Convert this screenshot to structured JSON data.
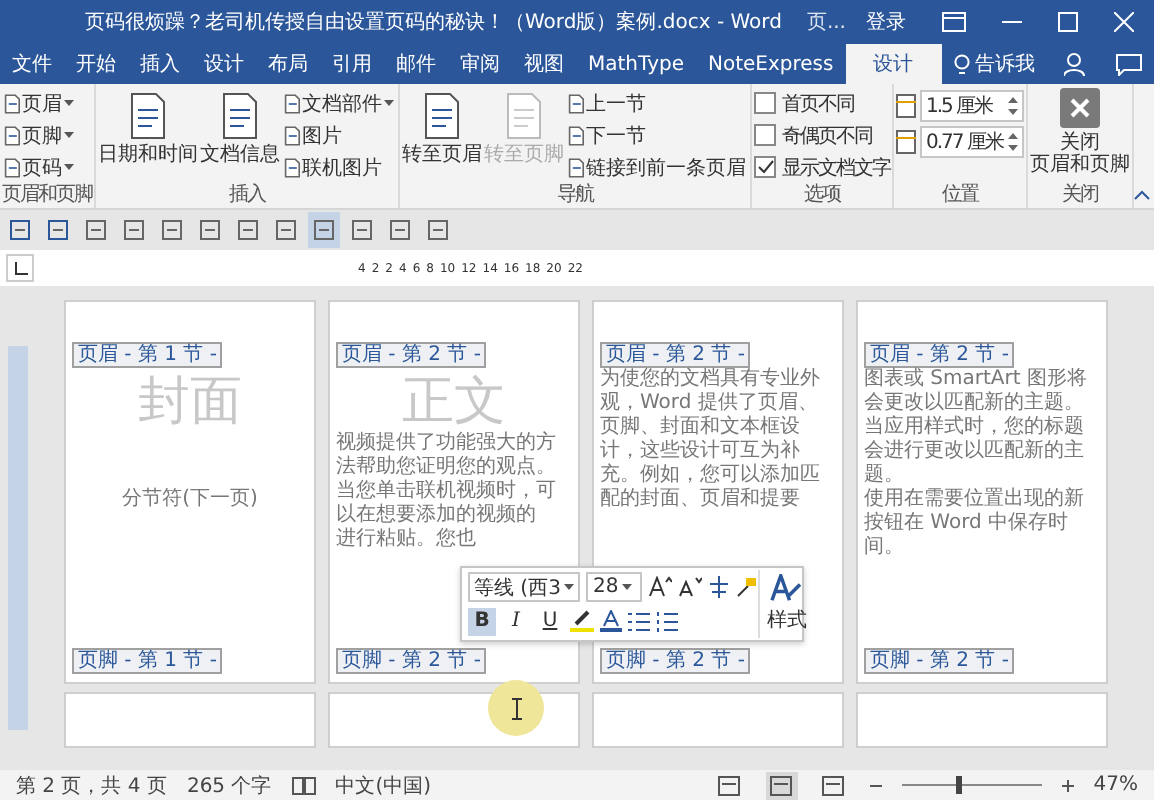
{
  "window": {
    "title": "页码很烦躁？老司机传授自由设置页码的秘诀！（Word版）案例.docx - Word",
    "account": "页...",
    "sign_in": "登录"
  },
  "tabs": [
    {
      "label": "文件",
      "selected": false
    },
    {
      "label": "开始",
      "selected": false
    },
    {
      "label": "插入",
      "selected": false
    },
    {
      "label": "设计",
      "selected": false
    },
    {
      "label": "布局",
      "selected": false
    },
    {
      "label": "引用",
      "selected": false
    },
    {
      "label": "邮件",
      "selected": false
    },
    {
      "label": "审阅",
      "selected": false
    },
    {
      "label": "视图",
      "selected": false
    },
    {
      "label": "MathType",
      "selected": false
    },
    {
      "label": "NoteExpress",
      "selected": false
    },
    {
      "label": "设计",
      "selected": true
    }
  ],
  "tell_me": "告诉我",
  "ribbon": [
    {
      "label": "页眉和页脚",
      "items": [
        {
          "kind": "small",
          "label": "页眉",
          "dropdown": true,
          "disabled": false
        },
        {
          "kind": "small",
          "label": "页脚",
          "dropdown": true,
          "disabled": false
        },
        {
          "kind": "small",
          "label": "页码",
          "dropdown": true,
          "disabled": false
        }
      ]
    },
    {
      "label": "插入",
      "items": [
        {
          "kind": "large",
          "label": "日期和时间",
          "disabled": false
        },
        {
          "kind": "large",
          "label": "文档信息",
          "disabled": false
        },
        {
          "kind": "small",
          "label": "文档部件",
          "dropdown": true,
          "disabled": false
        },
        {
          "kind": "small",
          "label": "图片",
          "dropdown": false,
          "disabled": false
        },
        {
          "kind": "small",
          "label": "联机图片",
          "dropdown": false,
          "disabled": false
        }
      ]
    },
    {
      "label": "导航",
      "items": [
        {
          "kind": "large",
          "label": "转至页眉",
          "disabled": false
        },
        {
          "kind": "large",
          "label": "转至页脚",
          "disabled": true
        },
        {
          "kind": "small",
          "label": "上一节",
          "dropdown": false,
          "disabled": false
        },
        {
          "kind": "small",
          "label": "下一节",
          "dropdown": false,
          "disabled": false
        },
        {
          "kind": "small",
          "label": "链接到前一条页眉",
          "dropdown": false,
          "disabled": false
        }
      ]
    },
    {
      "label": "选项",
      "items": [
        {
          "kind": "check",
          "label": "首页不同",
          "checked": false
        },
        {
          "kind": "check",
          "label": "奇偶页不同",
          "checked": false
        },
        {
          "kind": "check",
          "label": "显示文档文字",
          "checked": true
        }
      ]
    },
    {
      "label": "位置",
      "items": [
        {
          "kind": "spin",
          "value": "1.5 厘米"
        },
        {
          "kind": "spin",
          "value": "0.77 厘米"
        }
      ]
    },
    {
      "label": "关闭",
      "items": [
        {
          "kind": "close",
          "label_lines": [
            "关闭",
            "页眉和页脚"
          ]
        }
      ]
    }
  ],
  "quick_access": [
    {
      "pressed": false
    },
    {
      "pressed": false
    },
    {
      "pressed": false
    },
    {
      "pressed": false
    },
    {
      "pressed": false
    },
    {
      "pressed": false
    },
    {
      "pressed": false
    },
    {
      "pressed": false
    },
    {
      "pressed": true
    },
    {
      "pressed": false
    },
    {
      "pressed": false
    },
    {
      "pressed": false
    }
  ],
  "ruler": {
    "labels": [
      "4",
      "2",
      "2",
      "4",
      "6",
      "8",
      "10",
      "12",
      "14",
      "16",
      "18",
      "20",
      "22"
    ]
  },
  "pages": [
    {
      "header_tag": "页眉 - 第 1 节 -",
      "title": "封面",
      "section_break": "分节符(下一页)",
      "footer_tag": "页脚 - 第 1 节 -"
    },
    {
      "header_tag": "页眉 - 第 2 节 -",
      "title": "正文",
      "paragraphs": [
        "视频提供了功能强大的方法帮助您证明您的观点。当您单击联机视频时，可以在想要添加的视频的",
        "进行粘贴。您也"
      ],
      "footer_tag": "页脚 - 第 2 节 -"
    },
    {
      "header_tag": "页眉 - 第 2 节 -",
      "paragraphs": [
        "为使您的文档具有专业外观，Word 提供了页眉、页脚、封面和文本框设计，这些设计可互为补充。例如，您可以添加匹配的封面、页眉和提要"
      ],
      "footer_tag": "页脚 - 第 2 节 -"
    },
    {
      "header_tag": "页眉 - 第 2 节 -",
      "paragraphs": [
        "图表或 SmartArt 图形将会更改以匹配新的主题。当应用样式时，您的标题会进行更改以匹配新的主题。",
        "使用在需要位置出现的新按钮在 Word 中保存时间。"
      ],
      "footer_tag": "页脚 - 第 2 节 -"
    }
  ],
  "mini_toolbar": {
    "font": "等线 (西3",
    "size": "28",
    "format_buttons": [
      {
        "label": "B",
        "pressed": true
      },
      {
        "label": "I",
        "pressed": false
      },
      {
        "label": "U",
        "pressed": false
      }
    ],
    "styles": "样式"
  },
  "status_bar": {
    "page": "第 2 页，共 4 页",
    "words": "265 个字",
    "language": "中文(中国)",
    "views": [
      {
        "selected": false
      },
      {
        "selected": true
      },
      {
        "selected": false
      }
    ],
    "zoom": {
      "level": 0.4,
      "reading": "47%"
    }
  }
}
